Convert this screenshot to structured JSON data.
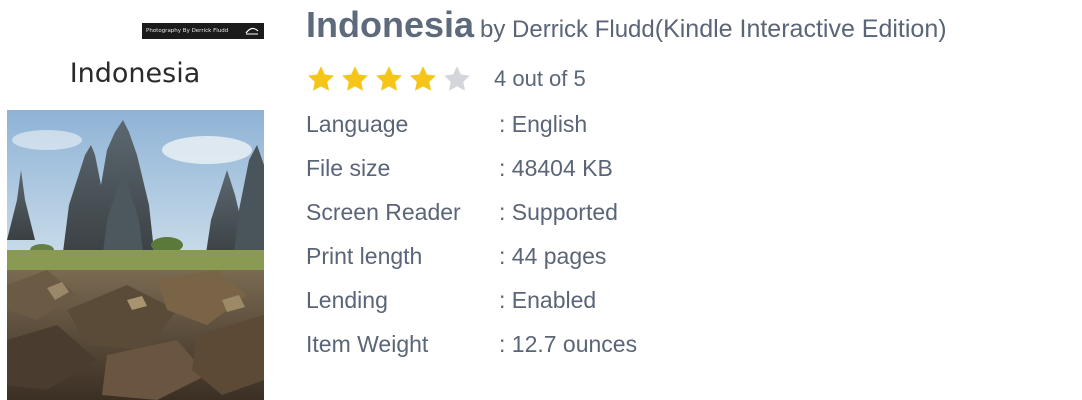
{
  "cover": {
    "credit": "Photography By Derrick Fludd",
    "title": "Indonesia"
  },
  "book": {
    "title": "Indonesia",
    "by_author": "by Derrick Fludd",
    "edition": "(Kindle Interactive Edition)"
  },
  "rating": {
    "value": 4,
    "max": 5,
    "text": "4 out of 5",
    "filled_color": "#f5c518",
    "empty_color": "#d3d6db"
  },
  "details": [
    {
      "label": "Language",
      "value": ": English"
    },
    {
      "label": "File size",
      "value": ": 48404 KB"
    },
    {
      "label": "Screen Reader",
      "value": ": Supported"
    },
    {
      "label": "Print length",
      "value": ": 44 pages"
    },
    {
      "label": "Lending",
      "value": ": Enabled"
    },
    {
      "label": "Item Weight",
      "value": ": 12.7 ounces"
    }
  ]
}
